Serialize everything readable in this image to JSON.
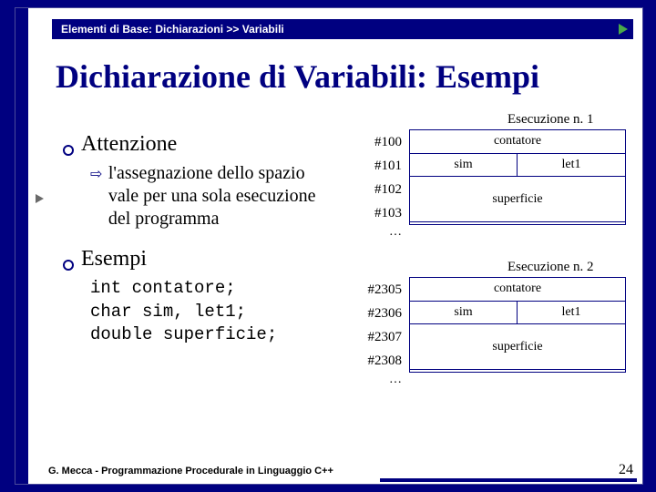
{
  "header": {
    "breadcrumb": "Elementi di Base: Dichiarazioni >> Variabili"
  },
  "title": "Dichiarazione di Variabili: Esempi",
  "sections": {
    "attenzione": {
      "label": "Attenzione",
      "sub": "l'assegnazione dello spazio vale per una sola esecuzione del programma"
    },
    "esempi": {
      "label": "Esempi",
      "code1": "int contatore;",
      "code2": "char sim, let1;",
      "code3": "double superficie;"
    }
  },
  "memory": {
    "exec1": {
      "title": "Esecuzione n. 1",
      "rows": [
        {
          "addr": "#100",
          "full": "contatore"
        },
        {
          "addr": "#101",
          "half": [
            "sim",
            "let1"
          ]
        },
        {
          "addr": "#102"
        },
        {
          "addr": "#103"
        }
      ],
      "superficie_label": "superficie",
      "dots": "…"
    },
    "exec2": {
      "title": "Esecuzione n. 2",
      "rows": [
        {
          "addr": "#2305",
          "full": "contatore"
        },
        {
          "addr": "#2306",
          "half": [
            "sim",
            "let1"
          ]
        },
        {
          "addr": "#2307"
        },
        {
          "addr": "#2308"
        }
      ],
      "superficie_label": "superficie",
      "dots": "…"
    }
  },
  "footer": "G. Mecca - Programmazione Procedurale in Linguaggio C++",
  "page": "24"
}
